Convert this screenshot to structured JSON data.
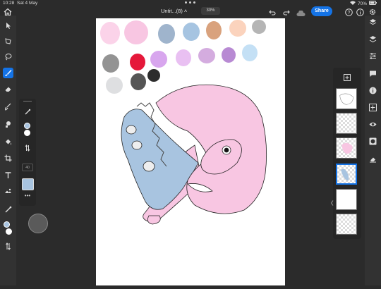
{
  "status": {
    "time": "10:28",
    "date": "Sat 4 May",
    "battery": "70%"
  },
  "topbar": {
    "doc_title": "Untit...(8) ˄",
    "zoom": "30%",
    "share_label": "Share"
  },
  "left_tools": [
    {
      "name": "home-icon"
    },
    {
      "name": "select-arrow-icon"
    },
    {
      "name": "transform-icon"
    },
    {
      "name": "lasso-icon"
    },
    {
      "name": "brush-icon",
      "active": true
    },
    {
      "name": "eraser-icon"
    },
    {
      "name": "smudge-icon"
    },
    {
      "name": "clone-icon"
    },
    {
      "name": "fill-icon"
    },
    {
      "name": "crop-icon"
    },
    {
      "name": "text-icon"
    },
    {
      "name": "place-image-icon"
    },
    {
      "name": "eyedropper-icon"
    },
    {
      "name": "swap-colors-icon"
    }
  ],
  "brush_panel": {
    "size": "40",
    "color_hex": "#a8c4e0",
    "more_label": "•••"
  },
  "colors": {
    "foreground": "#a8c4e0",
    "background": "#ffffff",
    "accent": "#1473e6"
  },
  "palette": [
    "#fbd3e9",
    "#f8c6e2",
    "#9fb4cc",
    "#a6c4e1",
    "#d9a27d",
    "#fbd3bd",
    "#b5b5b5",
    "#939393",
    "#e5183a",
    "#d8a6ee",
    "#e9c0f2",
    "#d4acdf",
    "#b88ad3",
    "#c4e0f5",
    "#dedfe1",
    "#555555",
    "#2d2d2d"
  ],
  "layers": [
    {
      "name": "layer-sketch"
    },
    {
      "name": "layer-empty-1"
    },
    {
      "name": "layer-pink"
    },
    {
      "name": "layer-blue",
      "selected": true
    },
    {
      "name": "layer-white"
    },
    {
      "name": "layer-empty-2"
    }
  ],
  "right_tools": [
    {
      "name": "layers-icon"
    },
    {
      "name": "layer-properties-icon"
    },
    {
      "name": "adjustments-icon"
    },
    {
      "name": "comments-icon"
    },
    {
      "name": "info-icon"
    },
    {
      "name": "add-layer-icon"
    },
    {
      "name": "visibility-icon"
    },
    {
      "name": "mask-icon"
    },
    {
      "name": "clear-icon"
    }
  ]
}
